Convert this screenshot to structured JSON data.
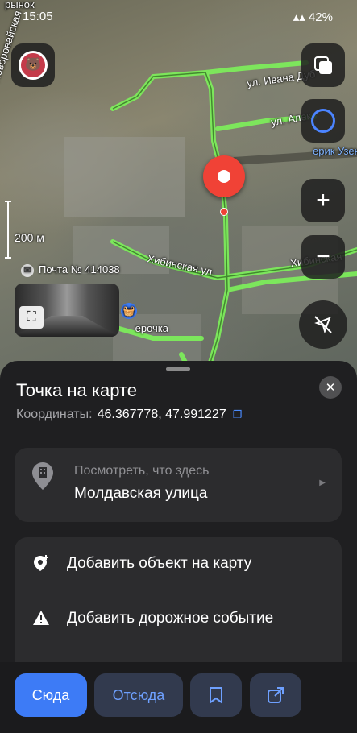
{
  "status_bar": {
    "time": "15:05",
    "battery": "42%"
  },
  "map": {
    "labels": {
      "street_ivana": "ул. Ивана Дуб",
      "street_alek": "ул. Алек",
      "erik": "ерик Узен",
      "novo": "ул. Новоровайская",
      "scale": "200 м",
      "post": "Почта № 414038",
      "khibin": "Хибинская ул.",
      "khibin2": "Хибинская",
      "store": "ерочка",
      "rynok": "рынок"
    }
  },
  "sheet": {
    "title": "Точка на карте",
    "coords_label": "Координаты:",
    "coords_value": "46.367778, 47.991227",
    "info_card": {
      "subtitle": "Посмотреть, что здесь",
      "title": "Молдавская улица"
    },
    "actions": [
      "Добавить объект на карту",
      "Добавить дорожное событие"
    ]
  },
  "bottom_bar": {
    "here": "Сюда",
    "from": "Отсюда"
  },
  "colors": {
    "accent": "#3d7bf6",
    "pin": "#f04236",
    "route": "#7df25a"
  }
}
